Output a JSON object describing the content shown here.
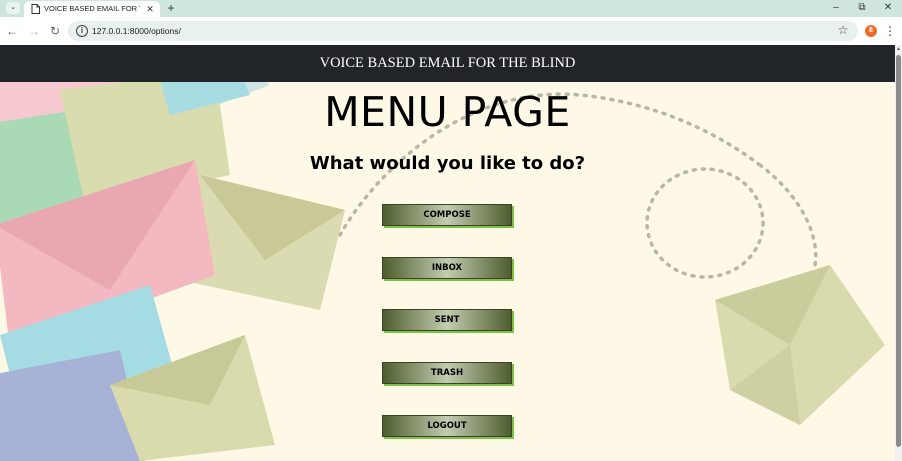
{
  "browser": {
    "tab": {
      "title": "VOICE BASED EMAIL FOR THE B",
      "favicon_icon": "page-icon",
      "close_glyph": "✕"
    },
    "new_tab_glyph": "+",
    "tab_menu_glyph": "⌄",
    "window_controls": {
      "minimize": "–",
      "maximize": "⧉",
      "close": "✕"
    },
    "nav": {
      "back": "←",
      "forward": "→",
      "reload": "↻"
    },
    "address_bar": {
      "url": "127.0.0.1:8000/options/",
      "info_glyph": "i"
    },
    "bookmark_glyph": "☆",
    "profile_initial": "8",
    "menu_glyph": "⋮"
  },
  "page": {
    "header_title": "VOICE BASED EMAIL FOR THE BLIND",
    "title": "MENU PAGE",
    "subtitle": "What would you like to do?",
    "buttons": [
      "COMPOSE",
      "INBOX",
      "SENT",
      "TRASH",
      "LOGOUT"
    ],
    "colors": {
      "header_bg": "#212529",
      "page_bg": "#fdf9e6",
      "button_dark": "#4e5d2f",
      "button_light": "#c2ccb0",
      "button_shadow": "#7cc244"
    }
  }
}
